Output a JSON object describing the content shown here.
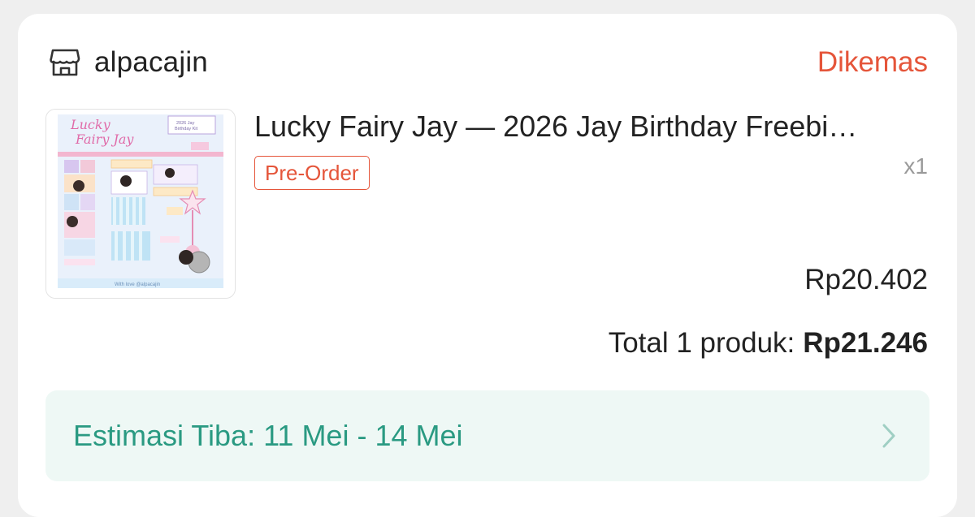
{
  "shop": {
    "icon": "store-icon",
    "name": "alpacajin",
    "status": "Dikemas"
  },
  "product": {
    "title": "Lucky Fairy Jay — 2026 Jay Birthday Freebi…",
    "badge": "Pre-Order",
    "quantity": "x1",
    "price": "Rp20.402",
    "thumbnail": {
      "heading": "Lucky Fairy Jay",
      "corner_label_1": "2026 Jay",
      "corner_label_2": "Birthday Kit",
      "footer": "With love @alpacajin"
    }
  },
  "total": {
    "label": "Total 1 produk:",
    "value": "Rp21.246"
  },
  "eta": {
    "text": "Estimasi Tiba: 11 Mei - 14 Mei",
    "icon": "chevron-right-icon"
  },
  "colors": {
    "accent": "#e5553a",
    "eta_text": "#2a9a82",
    "eta_bg": "#eef8f5",
    "chevron": "#9fcfc3"
  }
}
